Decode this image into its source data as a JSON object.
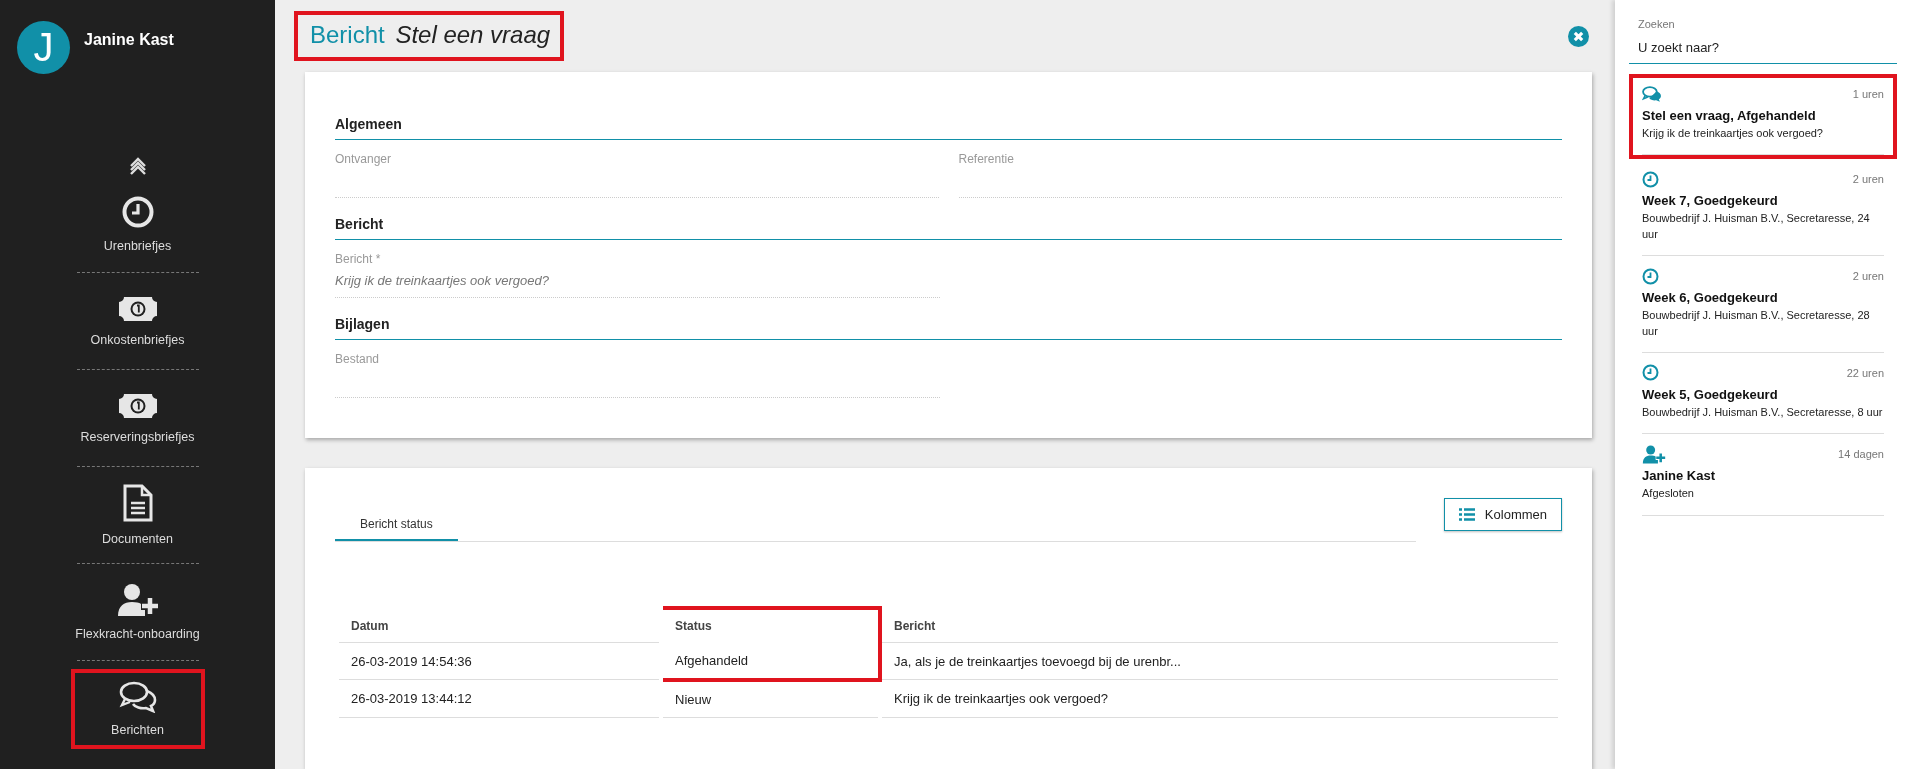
{
  "user": {
    "initial": "J",
    "name": "Janine Kast"
  },
  "nav_items": [
    {
      "label": "Urenbriefjes",
      "kind": "clock",
      "highlighted": false
    },
    {
      "label": "Onkostenbriefjes",
      "kind": "bill",
      "highlighted": false
    },
    {
      "label": "Reserveringsbriefjes",
      "kind": "bill",
      "highlighted": false
    },
    {
      "label": "Documenten",
      "kind": "document",
      "highlighted": false
    },
    {
      "label": "Flexkracht-onboarding",
      "kind": "person",
      "highlighted": false
    },
    {
      "label": "Berichten",
      "kind": "message",
      "highlighted": true
    }
  ],
  "header": {
    "title": "Bericht",
    "subtitle": "Stel een vraag",
    "highlighted": true
  },
  "form": {
    "sections": [
      {
        "title": "Algemeen",
        "fields": [
          {
            "label": "Ontvanger"
          },
          {
            "label": "Referentie"
          }
        ]
      },
      {
        "title": "Bericht",
        "fields": [
          {
            "label": "Bericht *",
            "value": "Krijg ik de treinkaartjes ook vergoed?"
          }
        ]
      },
      {
        "title": "Bijlagen",
        "fields": [
          {
            "label": "Bestand"
          }
        ]
      }
    ]
  },
  "status": {
    "tabs": [
      {
        "label": "Bericht status",
        "selected": true
      }
    ],
    "columns_button": "Kolommen",
    "table": {
      "columns": [
        {
          "label": "Datum",
          "highlighted": false
        },
        {
          "label": "Status",
          "highlighted": true
        },
        {
          "label": "Bericht",
          "highlighted": false
        }
      ],
      "rows": [
        {
          "cells": [
            "26-03-2019 14:54:36",
            "Afgehandeld",
            "Ja, als je de treinkaartjes toevoegd bij de urenbr..."
          ],
          "highlighted": true
        },
        {
          "cells": [
            "26-03-2019 13:44:12",
            "Nieuw",
            "Krijg ik de treinkaartjes ook vergoed?"
          ],
          "highlighted": false
        }
      ]
    }
  },
  "search": {
    "label": "Zoeken",
    "placeholder": "U zoekt naar?"
  },
  "feed": [
    {
      "kind": "message",
      "time": "1 uren",
      "title": "Stel een vraag, Afgehandeld",
      "text": "Krijg ik de treinkaartjes ook vergoed?",
      "highlighted": true
    },
    {
      "kind": "clock",
      "time": "2 uren",
      "title": "Week 7, Goedgekeurd",
      "text": "Bouwbedrijf J. Huisman B.V., Secretaresse, 24 uur",
      "highlighted": false
    },
    {
      "kind": "clock",
      "time": "2 uren",
      "title": "Week 6, Goedgekeurd",
      "text": "Bouwbedrijf J. Huisman B.V., Secretaresse, 28 uur",
      "highlighted": false
    },
    {
      "kind": "clock",
      "time": "22 uren",
      "title": "Week 5, Goedgekeurd",
      "text": "Bouwbedrijf J. Huisman B.V., Secretaresse, 8 uur",
      "highlighted": false
    },
    {
      "kind": "person",
      "time": "14 dagen",
      "title": "Janine Kast",
      "text": "Afgesloten",
      "highlighted": false
    }
  ]
}
